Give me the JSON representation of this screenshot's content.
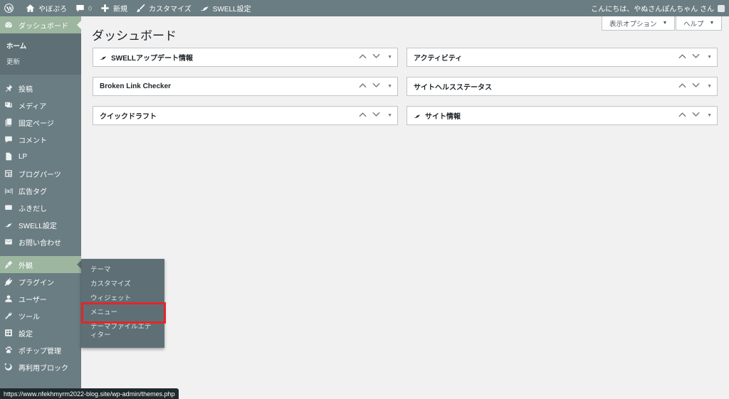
{
  "admin_bar": {
    "site_name": "やぼぷろ",
    "comments_count": "0",
    "new_label": "新規",
    "customize_label": "カスタマイズ",
    "swell_label": "SWELL設定",
    "greeting": "こんにちは、やぬさんぽんちゃん さん"
  },
  "sidebar": {
    "dashboard": "ダッシュボード",
    "home": "ホーム",
    "updates": "更新",
    "items": [
      {
        "label": "投稿",
        "icon": "pin-icon"
      },
      {
        "label": "メディア",
        "icon": "media-icon"
      },
      {
        "label": "固定ページ",
        "icon": "page-icon"
      },
      {
        "label": "コメント",
        "icon": "comment-icon"
      },
      {
        "label": "LP",
        "icon": "lp-icon"
      },
      {
        "label": "ブログパーツ",
        "icon": "blog-parts-icon"
      },
      {
        "label": "広告タグ",
        "icon": "ad-icon",
        "glyph": "[ad]"
      },
      {
        "label": "ふきだし",
        "icon": "balloon-icon"
      },
      {
        "label": "SWELL設定",
        "icon": "swell-icon"
      },
      {
        "label": "お問い合わせ",
        "icon": "mail-icon"
      }
    ],
    "appearance": "外観",
    "items2": [
      {
        "label": "プラグイン",
        "icon": "plugin-icon"
      },
      {
        "label": "ユーザー",
        "icon": "user-icon"
      },
      {
        "label": "ツール",
        "icon": "tool-icon"
      },
      {
        "label": "設定",
        "icon": "settings-icon"
      },
      {
        "label": "ポチップ管理",
        "icon": "paw-icon"
      },
      {
        "label": "再利用ブロック",
        "icon": "reuse-icon"
      }
    ]
  },
  "flyout": {
    "items": [
      "テーマ",
      "カスタマイズ",
      "ウィジェット",
      "メニュー",
      "テーマファイルエディター"
    ]
  },
  "main": {
    "title": "ダッシュボード",
    "screen_options": "表示オプション",
    "help": "ヘルプ",
    "postboxes_left": [
      "SWELLアップデート情報",
      "Broken Link Checker",
      "クイックドラフト"
    ],
    "postboxes_right": [
      "アクティビティ",
      "サイトヘルスステータス",
      "サイト情報"
    ]
  },
  "status_url": "https://www.nfekhmyrm2022-blog.site/wp-admin/themes.php",
  "colors": {
    "accent": "#9db6a0",
    "sidebar": "#6a7d82",
    "highlight": "#e2262b"
  }
}
